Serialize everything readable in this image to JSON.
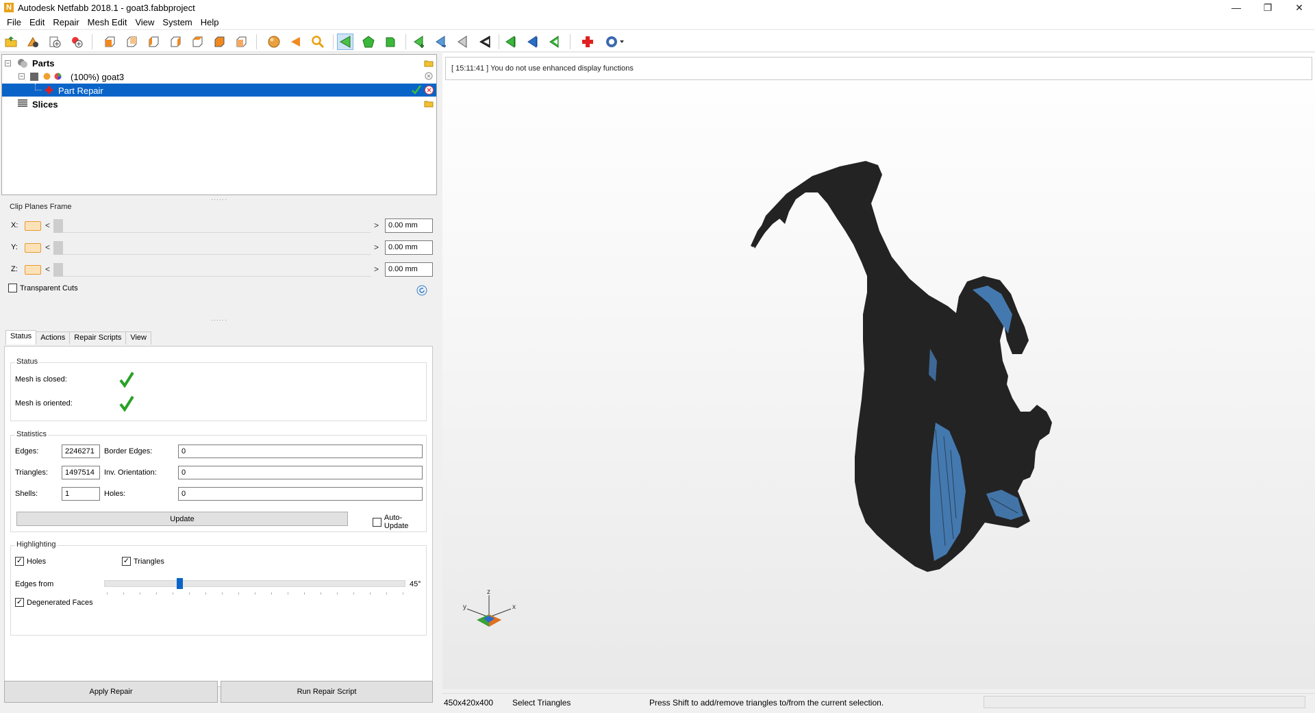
{
  "window": {
    "title": "Autodesk Netfabb 2018.1 - goat3.fabbproject",
    "app_icon_letter": "N",
    "controls": {
      "minimize": "—",
      "restore": "❐",
      "close": "✕"
    }
  },
  "menu": [
    "File",
    "Edit",
    "Repair",
    "Mesh Edit",
    "View",
    "System",
    "Help"
  ],
  "toolbar": {
    "icons": [
      "open-project-icon",
      "add-part-icon",
      "add-slice-icon",
      "new-icon",
      "view-front-icon",
      "view-back-icon",
      "view-left-icon",
      "view-right-icon",
      "view-top-icon",
      "view-bottom-icon",
      "view-iso-icon",
      "sphere-icon",
      "arrow-left-icon",
      "zoom-icon",
      "select-triangle-icon",
      "select-surface-icon",
      "select-shell-icon",
      "add-triangle-icon",
      "remove-triangle-icon",
      "selection-tool-icon",
      "invert-selection-icon",
      "flip-green-icon",
      "flip-blue-icon",
      "flip-green-outline-icon",
      "repair-cross-icon",
      "help-dropdown-icon"
    ]
  },
  "tree": {
    "parts_label": "Parts",
    "goat_label": "(100%) goat3",
    "repair_label": "Part Repair",
    "slices_label": "Slices"
  },
  "clip": {
    "title": "Clip Planes Frame",
    "rows": [
      {
        "axis": "X:",
        "value": "0.00 mm"
      },
      {
        "axis": "Y:",
        "value": "0.00 mm"
      },
      {
        "axis": "Z:",
        "value": "0.00 mm"
      }
    ],
    "lt": "<",
    "gt": ">",
    "transparent_cuts": "Transparent Cuts"
  },
  "tabs": [
    "Status",
    "Actions",
    "Repair Scripts",
    "View"
  ],
  "status_group": {
    "title": "Status",
    "mesh_closed": "Mesh is closed:",
    "mesh_oriented": "Mesh is oriented:"
  },
  "statistics": {
    "title": "Statistics",
    "edges_label": "Edges:",
    "edges_value": "2246271",
    "border_edges_label": "Border Edges:",
    "border_edges_value": "0",
    "triangles_label": "Triangles:",
    "triangles_value": "1497514",
    "inv_orientation_label": "Inv. Orientation:",
    "inv_orientation_value": "0",
    "shells_label": "Shells:",
    "shells_value": "1",
    "holes_label": "Holes:",
    "holes_value": "0",
    "update_label": "Update",
    "auto_update_label": "Auto-Update"
  },
  "highlighting": {
    "title": "Highlighting",
    "holes_label": "Holes",
    "triangles_label": "Triangles",
    "edges_from_label": "Edges from",
    "edges_from_value": "45°",
    "edges_from_fraction": 0.25,
    "degenerated_label": "Degenerated Faces"
  },
  "buttons": {
    "apply_repair": "Apply Repair",
    "run_repair_script": "Run Repair Script"
  },
  "viewport": {
    "log_message": "[ 15:11:41 ] You do not use enhanced display functions",
    "axis_x": "x",
    "axis_y": "y",
    "axis_z": "z"
  },
  "statusbar": {
    "dimensions": "450x420x400",
    "mode": "Select Triangles",
    "hint": "Press Shift to add/remove triangles to/from the current selection."
  },
  "colors": {
    "selection": "#0a64c8",
    "mesh": "#222222",
    "highlight": "#4a88c8",
    "check_green": "#2aa02a"
  }
}
